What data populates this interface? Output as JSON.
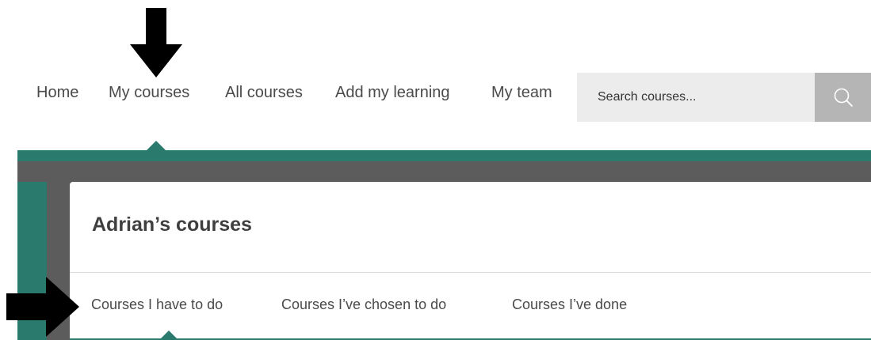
{
  "nav": {
    "items": [
      {
        "label": "Home"
      },
      {
        "label": "My courses"
      },
      {
        "label": "All courses"
      },
      {
        "label": "Add my learning"
      },
      {
        "label": "My team"
      }
    ],
    "active_index": 1
  },
  "search": {
    "placeholder": "Search courses...",
    "button_icon": "search-icon"
  },
  "card": {
    "title": "Adrian’s courses",
    "tabs": [
      {
        "label": "Courses I have to do"
      },
      {
        "label": "Courses I’ve chosen to do"
      },
      {
        "label": "Courses I’ve done"
      }
    ],
    "active_tab_index": 0
  },
  "annotations": {
    "arrows": [
      "down-arrow-icon",
      "right-arrow-icon"
    ]
  },
  "colors": {
    "accent": "#2a7a6e",
    "band": "#5c5c5c",
    "search_bg": "#ececec",
    "search_button": "#b5b5b5",
    "text": "#4a4a4a"
  }
}
